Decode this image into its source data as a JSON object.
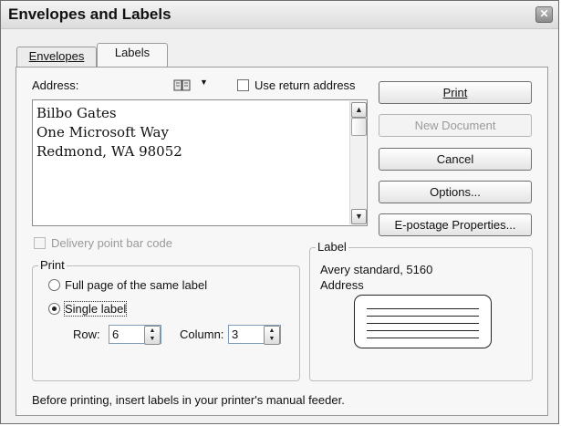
{
  "window": {
    "title": "Envelopes and Labels",
    "close_symbol": "✕"
  },
  "tabs": [
    {
      "label": "Envelopes",
      "active": false
    },
    {
      "label": "Labels",
      "active": true
    }
  ],
  "address": {
    "label": "Address:",
    "book_icon": "address-book-icon",
    "use_return_address": "Use return address",
    "lines": [
      "Bilbo Gates",
      "One Microsoft Way",
      "Redmond, WA 98052"
    ]
  },
  "buttons": {
    "print": "Print",
    "new_document": "New Document",
    "cancel": "Cancel",
    "options": "Options...",
    "epostage": "E-postage Properties..."
  },
  "delivery_bar_code": "Delivery point bar code",
  "print_group": {
    "legend": "Print",
    "full_page": "Full page of the same label",
    "single_label": "Single label",
    "row_label": "Row:",
    "row_value": "6",
    "column_label": "Column:",
    "column_value": "3"
  },
  "label_group": {
    "legend": "Label",
    "standard": "Avery standard, 5160",
    "type": "Address"
  },
  "footer_note": "Before printing, insert labels in your printer's manual feeder."
}
